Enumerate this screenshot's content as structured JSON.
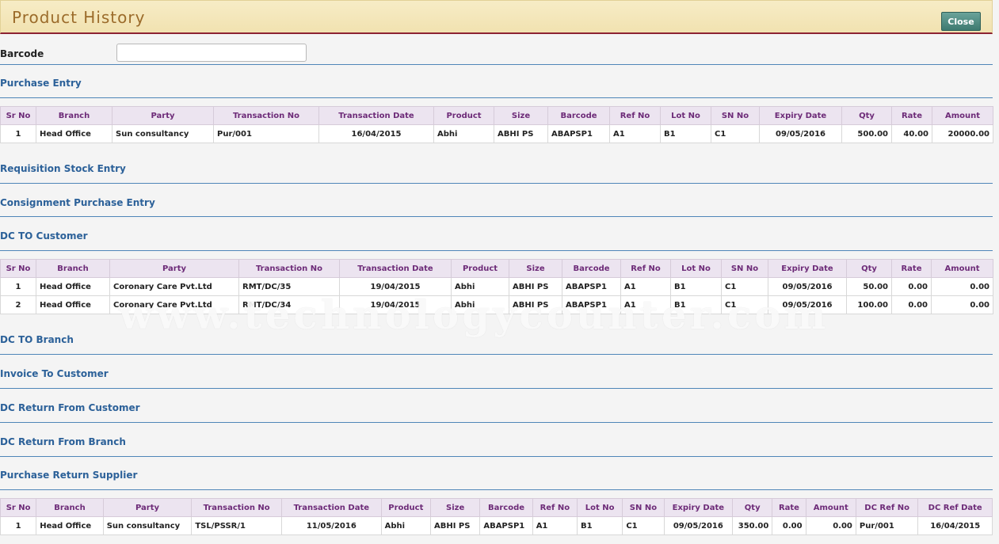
{
  "header": {
    "title": "Product History",
    "close_label": "Close"
  },
  "barcode": {
    "label": "Barcode",
    "value": ""
  },
  "sections": {
    "purchase_entry": "Purchase Entry",
    "requisition": "Requisition Stock Entry",
    "consignment": "Consignment Purchase Entry",
    "dc_customer": "DC TO Customer",
    "dc_branch": "DC TO Branch",
    "invoice_customer": "Invoice To Customer",
    "dc_return_customer": "DC Return From Customer",
    "dc_return_branch": "DC Return From Branch",
    "purchase_return": "Purchase Return Supplier"
  },
  "purchase_table": {
    "columns": [
      "Sr No",
      "Branch",
      "Party",
      "Transaction No",
      "Transaction Date",
      "Product",
      "Size",
      "Barcode",
      "Ref No",
      "Lot No",
      "SN No",
      "Expiry Date",
      "Qty",
      "Rate",
      "Amount"
    ],
    "rows": [
      [
        "1",
        "Head Office",
        "Sun consultancy",
        "Pur/001",
        "16/04/2015",
        "Abhi",
        "ABHI PS",
        "ABAPSP1",
        "A1",
        "B1",
        "C1",
        "09/05/2016",
        "500.00",
        "40.00",
        "20000.00"
      ]
    ]
  },
  "dc_table": {
    "columns": [
      "Sr No",
      "Branch",
      "Party",
      "Transaction No",
      "Transaction Date",
      "Product",
      "Size",
      "Barcode",
      "Ref No",
      "Lot No",
      "SN No",
      "Expiry Date",
      "Qty",
      "Rate",
      "Amount"
    ],
    "rows": [
      [
        "1",
        "Head Office",
        "Coronary Care Pvt.Ltd",
        "RMT/DC/35",
        "19/04/2015",
        "Abhi",
        "ABHI PS",
        "ABAPSP1",
        "A1",
        "B1",
        "C1",
        "09/05/2016",
        "50.00",
        "0.00",
        "0.00"
      ],
      [
        "2",
        "Head Office",
        "Coronary Care Pvt.Ltd",
        "RMT/DC/34",
        "19/04/2015",
        "Abhi",
        "ABHI PS",
        "ABAPSP1",
        "A1",
        "B1",
        "C1",
        "09/05/2016",
        "100.00",
        "0.00",
        "0.00"
      ]
    ]
  },
  "return_table": {
    "columns": [
      "Sr No",
      "Branch",
      "Party",
      "Transaction No",
      "Transaction Date",
      "Product",
      "Size",
      "Barcode",
      "Ref No",
      "Lot No",
      "SN No",
      "Expiry Date",
      "Qty",
      "Rate",
      "Amount",
      "DC Ref No",
      "DC Ref Date"
    ],
    "rows": [
      [
        "1",
        "Head Office",
        "Sun consultancy",
        "TSL/PSSR/1",
        "11/05/2016",
        "Abhi",
        "ABHI PS",
        "ABAPSP1",
        "A1",
        "B1",
        "C1",
        "09/05/2016",
        "350.00",
        "0.00",
        "0.00",
        "Pur/001",
        "16/04/2015"
      ]
    ]
  },
  "watermark": "www.technologycounter.com"
}
